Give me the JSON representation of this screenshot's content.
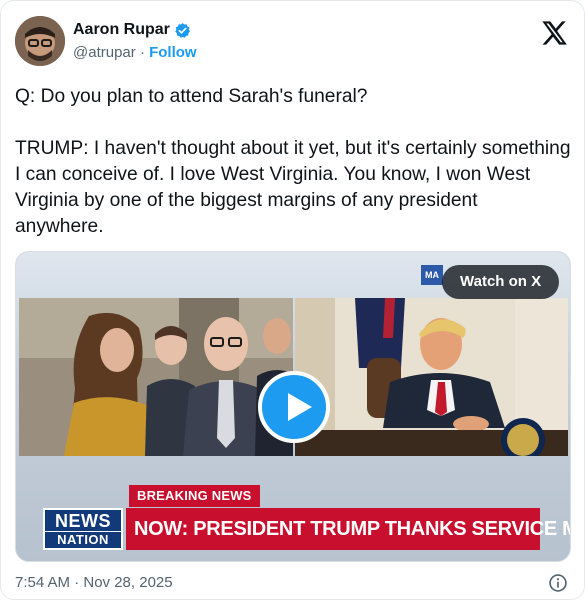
{
  "author": {
    "name": "Aaron Rupar",
    "handle": "@atrupar",
    "separator": "·",
    "follow_label": "Follow",
    "verified": true
  },
  "tweet": {
    "paragraphs": [
      "Q: Do you plan to attend Sarah's funeral?",
      "TRUMP: I haven't thought about it yet, but it's certainly something I can conceive of. I love West Virginia. You know, I won West Virginia by one of the biggest margins of any president anywhere."
    ]
  },
  "media": {
    "watch_label": "Watch on X",
    "corner_tag": "MA",
    "breaking_label": "BREAKING NEWS",
    "logo_top": "NEWS",
    "logo_bottom": "NATION",
    "headline": "NOW: PRESIDENT TRUMP THANKS SERVICE MEMBERS"
  },
  "footer": {
    "timestamp": "7:54 AM · Nov 28, 2025"
  },
  "colors": {
    "accent": "#1d9bf0",
    "text": "#0f1419",
    "muted": "#536471",
    "breaking_red": "#c8102e",
    "nation_blue": "#123a7a"
  },
  "icons": [
    "verified-badge-icon",
    "x-logo-icon",
    "play-icon",
    "info-icon"
  ]
}
